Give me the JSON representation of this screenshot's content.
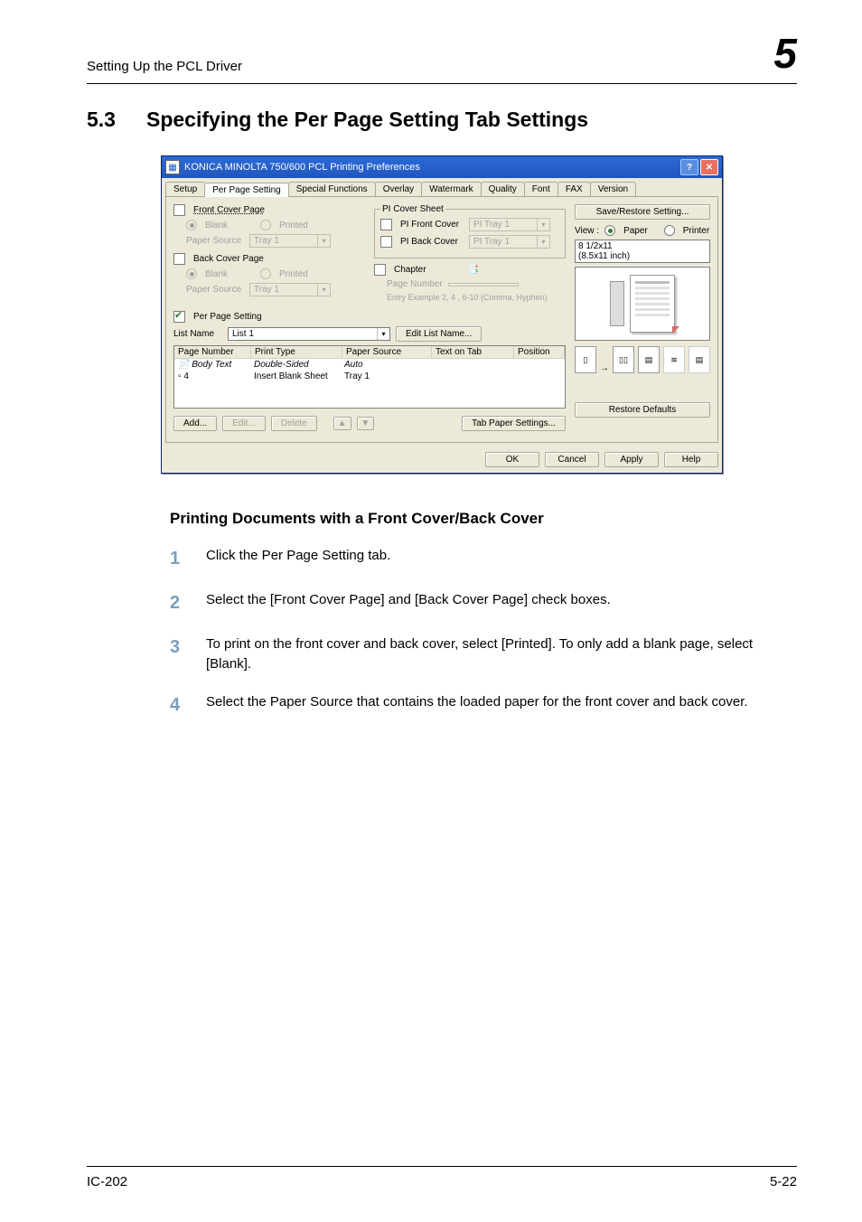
{
  "header": {
    "running": "Setting Up the PCL Driver",
    "chapter": "5"
  },
  "section": {
    "number": "5.3",
    "title": "Specifying the Per Page Setting Tab Settings"
  },
  "dialog": {
    "title": "KONICA MINOLTA 750/600 PCL Printing Preferences",
    "help_icon": "?",
    "close_icon": "✕",
    "tabs": [
      "Setup",
      "Per Page Setting",
      "Special Functions",
      "Overlay",
      "Watermark",
      "Quality",
      "Font",
      "FAX",
      "Version"
    ],
    "groups": {
      "front": {
        "label": "Front Cover Page",
        "blank": "Blank",
        "printed": "Printed",
        "paper_source_label": "Paper Source",
        "paper_source_value": "Tray 1"
      },
      "back": {
        "label": "Back Cover Page",
        "blank": "Blank",
        "printed": "Printed",
        "paper_source_label": "Paper Source",
        "paper_source_value": "Tray 1"
      },
      "pi": {
        "legend": "PI Cover Sheet",
        "front_label": "PI Front Cover",
        "front_value": "PI Tray 1",
        "back_label": "PI Back Cover",
        "back_value": "PI Tray 1"
      },
      "chapter": {
        "label": "Chapter",
        "page_number_label": "Page Number",
        "example": "Entry Example 2, 4 , 6-10 (Comma, Hyphen)"
      },
      "perpage": {
        "checkbox": "Per Page Setting",
        "list_name_label": "List Name",
        "list_name_value": "List 1",
        "edit_list_name": "Edit List Name..."
      },
      "list": {
        "headers": [
          "Page Number",
          "Print Type",
          "Paper Source",
          "Text on Tab",
          "Position"
        ],
        "rows": [
          {
            "pn": "Body Text",
            "pt": "Double-Sided",
            "ps": "Auto",
            "tt": "",
            "po": "",
            "italic": true,
            "icon": "📄"
          },
          {
            "pn": "4",
            "pt": "Insert Blank Sheet",
            "ps": "Tray 1",
            "tt": "",
            "po": "",
            "italic": false,
            "icon": "▫"
          }
        ]
      },
      "buttons": {
        "add": "Add...",
        "edit": "Edit...",
        "delete": "Delete",
        "up": "▲",
        "down": "▼",
        "tab_paper": "Tab Paper Settings..."
      }
    },
    "right": {
      "save_restore": "Save/Restore Setting...",
      "view_label": "View :",
      "view_paper": "Paper",
      "view_printer": "Printer",
      "size_line1": "8 1/2x11",
      "size_line2": "(8.5x11 inch)",
      "restore_defaults": "Restore Defaults"
    },
    "bottom": {
      "ok": "OK",
      "cancel": "Cancel",
      "apply": "Apply",
      "help": "Help"
    }
  },
  "body": {
    "subheading": "Printing Documents with a Front Cover/Back Cover",
    "steps": [
      "Click the Per Page Setting tab.",
      "Select the [Front Cover Page] and [Back Cover Page] check boxes.",
      "To print on the front cover and back cover, select [Printed]. To only add a blank page, select [Blank].",
      "Select the Paper Source that contains the loaded paper for the front cover and back cover."
    ]
  },
  "footer": {
    "left": "IC-202",
    "right": "5-22"
  }
}
